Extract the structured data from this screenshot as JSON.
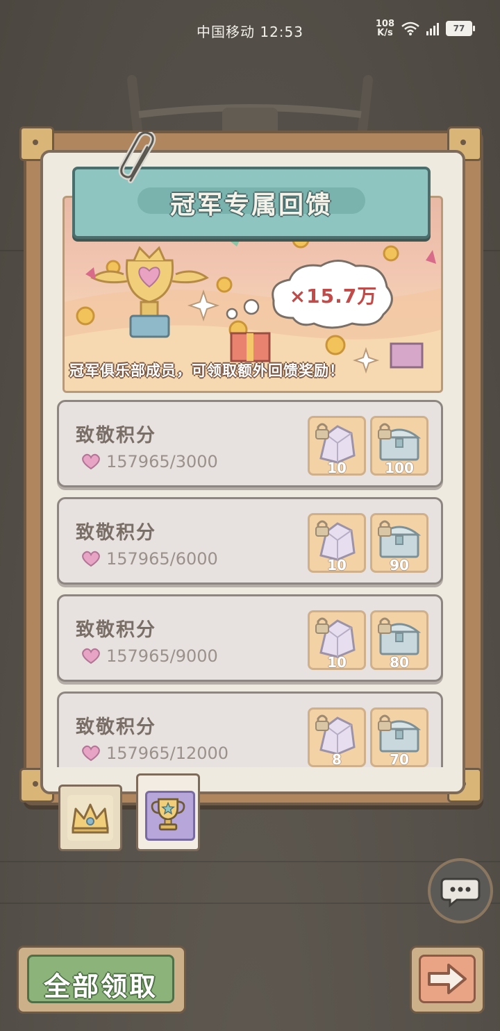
{
  "status_bar": {
    "carrier_time": "中国移动 12:53",
    "net_speed_value": "108",
    "net_speed_unit": "K/s",
    "battery": "77"
  },
  "banner": {
    "title": "冠军专属回馈"
  },
  "hero": {
    "bonus_amount": "×15.7万",
    "caption": "冠军俱乐部成员，可领取额外回馈奖励！"
  },
  "rows": [
    {
      "title": "致敬积分",
      "progress": "157965/3000",
      "rewards": [
        {
          "icon": "crystal-icon",
          "count": "10"
        },
        {
          "icon": "chest-icon",
          "count": "100"
        }
      ]
    },
    {
      "title": "致敬积分",
      "progress": "157965/6000",
      "rewards": [
        {
          "icon": "crystal-icon",
          "count": "10"
        },
        {
          "icon": "chest-icon",
          "count": "90"
        }
      ]
    },
    {
      "title": "致敬积分",
      "progress": "157965/9000",
      "rewards": [
        {
          "icon": "crystal-icon",
          "count": "10"
        },
        {
          "icon": "chest-icon",
          "count": "80"
        }
      ]
    },
    {
      "title": "致敬积分",
      "progress": "157965/12000",
      "rewards": [
        {
          "icon": "crystal-icon",
          "count": "8"
        },
        {
          "icon": "chest-icon",
          "count": "70"
        }
      ]
    }
  ],
  "tabs": [
    {
      "icon": "crown-icon",
      "selected": false
    },
    {
      "icon": "trophy-icon",
      "selected": true
    }
  ],
  "buttons": {
    "claim_all": "全部领取",
    "next_icon": "arrow-right-icon",
    "chat_icon": "chat-bubble-icon"
  },
  "colors": {
    "banner": "#8fc5c1",
    "row_bg": "#e7e2df",
    "reward_bg": "#f3d2a6",
    "claim_button": "#8bb37a",
    "next_button": "#e9a485",
    "bonus_text": "#c24a48"
  }
}
